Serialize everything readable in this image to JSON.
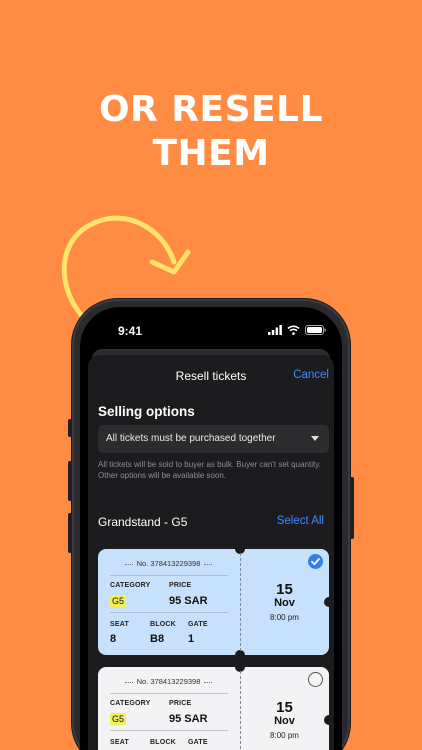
{
  "headline": {
    "line1": "OR RESELL",
    "line2": "THEM"
  },
  "status": {
    "time": "9:41"
  },
  "sheet": {
    "title": "Resell tickets",
    "cancel_label": "Cancel",
    "selling_options_title": "Selling options",
    "selling_option_value": "All tickets must be purchased together",
    "help_text": "All tickets will be sold to buyer as bulk. Buyer can't set quantity. Other options will be available soon.",
    "group_title": "Grandstand - G5",
    "select_all_label": "Select All"
  },
  "labels": {
    "category": "CATEGORY",
    "price": "PRICE",
    "seat": "SEAT",
    "block": "BLOCK",
    "gate": "GATE"
  },
  "tickets": [
    {
      "number": "No. 378413229398",
      "category": "G5",
      "price": "95 SAR",
      "seat": "8",
      "block": "B8",
      "gate": "1",
      "day": "15",
      "month": "Nov",
      "time": "8:00 pm",
      "selected": true
    },
    {
      "number": "No. 378413229398",
      "category": "G5",
      "price": "95 SAR",
      "seat": "",
      "block": "",
      "gate": "",
      "day": "15",
      "month": "Nov",
      "time": "8:00 pm",
      "selected": false
    }
  ],
  "colors": {
    "background": "#FF8C42",
    "accent": "#3d8bff",
    "selected_ticket": "#c7e0fb",
    "badge": "#f2ef5a"
  },
  "icons": [
    "signal-icon",
    "wifi-icon",
    "battery-icon",
    "chevron-down-icon",
    "checkmark-icon",
    "curved-arrow-doodle"
  ]
}
